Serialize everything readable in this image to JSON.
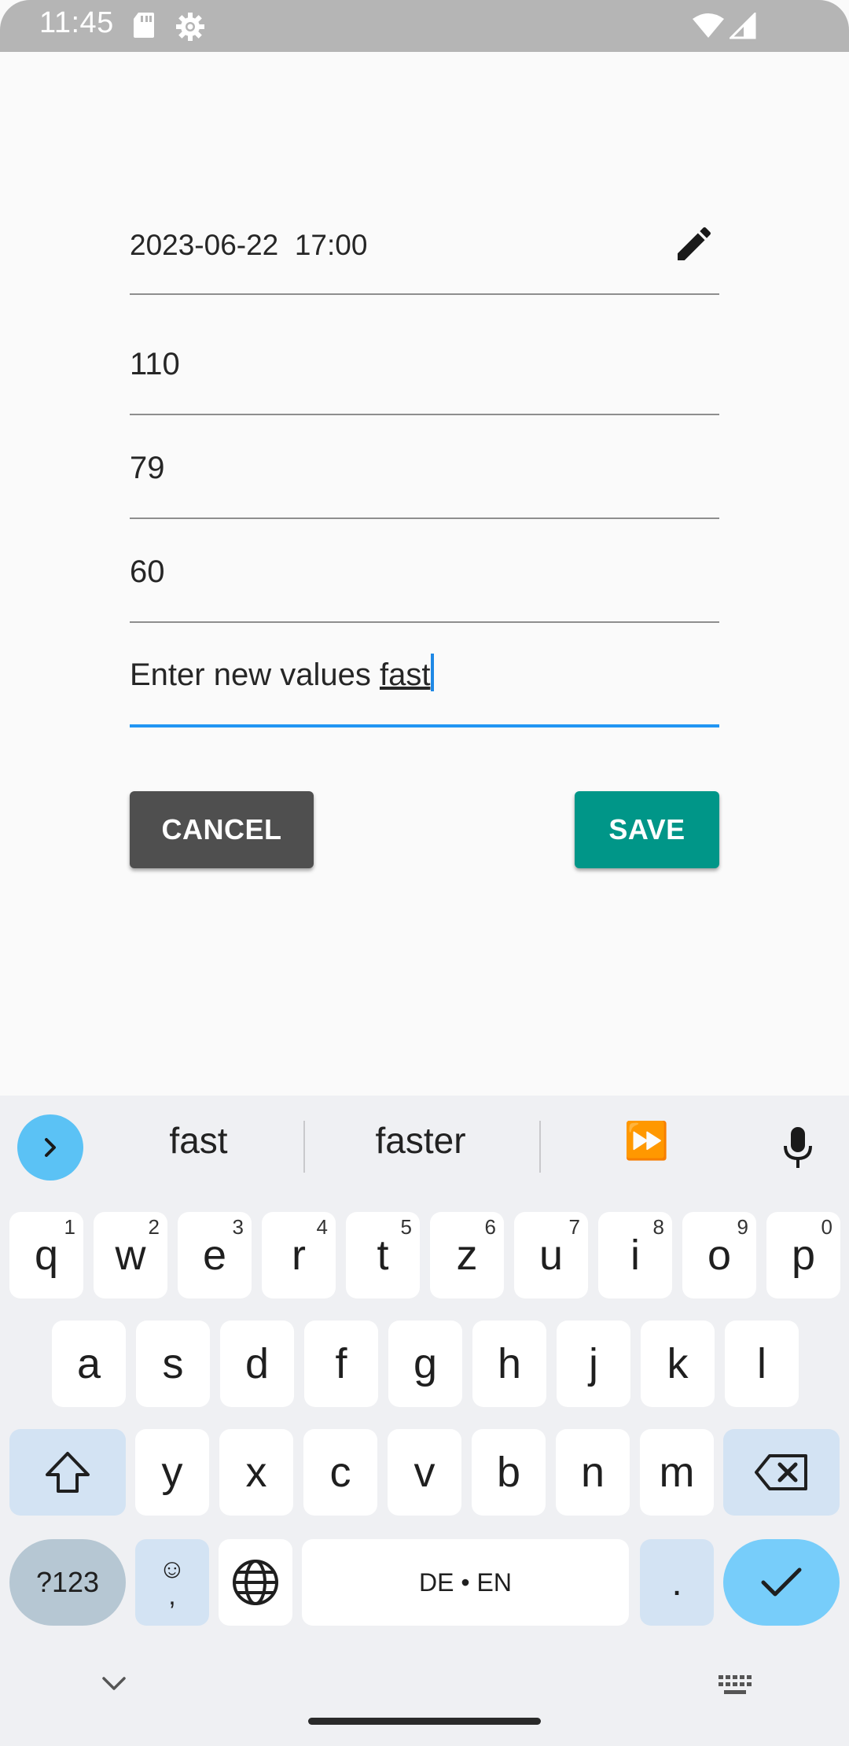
{
  "status_bar": {
    "time": "11:45",
    "icons": [
      "sd-card-icon",
      "settings-gear-icon",
      "wifi-icon",
      "signal-icon"
    ]
  },
  "form": {
    "datetime": "2023-06-22  17:00",
    "systolic": "110",
    "diastolic": "79",
    "pulse": "60",
    "note_prefix": "Enter new values ",
    "note_composing": "fast",
    "accent_color": "#2196f3"
  },
  "buttons": {
    "cancel": "CANCEL",
    "save": "SAVE",
    "save_color": "#009688",
    "cancel_color": "#4f4f4f"
  },
  "keyboard": {
    "suggestions": [
      "fast",
      "faster",
      "⏩"
    ],
    "row1": [
      {
        "k": "q",
        "h": "1"
      },
      {
        "k": "w",
        "h": "2"
      },
      {
        "k": "e",
        "h": "3"
      },
      {
        "k": "r",
        "h": "4"
      },
      {
        "k": "t",
        "h": "5"
      },
      {
        "k": "z",
        "h": "6"
      },
      {
        "k": "u",
        "h": "7"
      },
      {
        "k": "i",
        "h": "8"
      },
      {
        "k": "o",
        "h": "9"
      },
      {
        "k": "p",
        "h": "0"
      }
    ],
    "row2": [
      "a",
      "s",
      "d",
      "f",
      "g",
      "h",
      "j",
      "k",
      "l"
    ],
    "row3": [
      "y",
      "x",
      "c",
      "v",
      "b",
      "n",
      "m"
    ],
    "symbols_label": "?123",
    "emoji_top": "☺",
    "emoji_bottom": ",",
    "space_label": "DE • EN",
    "period_label": "."
  }
}
